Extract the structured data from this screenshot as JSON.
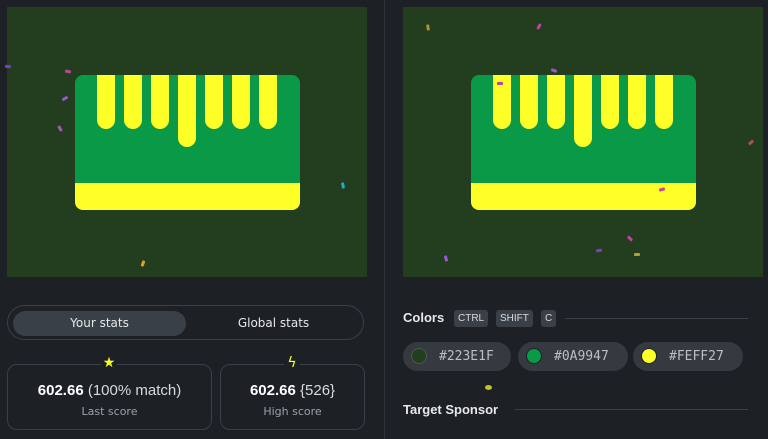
{
  "stats_tabs": {
    "your_stats": "Your stats",
    "global_stats": "Global stats"
  },
  "last_score": {
    "value": "602.66",
    "match": "(100% match)",
    "label": "Last score"
  },
  "high_score": {
    "value": "602.66",
    "rank": "{526}",
    "label": "High score"
  },
  "colors_section": {
    "title": "Colors",
    "shortcut": [
      "CTRL",
      "SHIFT",
      "C"
    ],
    "swatches": [
      {
        "hex": "#223E1F",
        "label": "#223E1F"
      },
      {
        "hex": "#0A9947",
        "label": "#0A9947"
      },
      {
        "hex": "#FEFF27",
        "label": "#FEFF27"
      }
    ]
  },
  "target_sponsor": {
    "title": "Target Sponsor"
  },
  "palette": {
    "background": "#223E1F",
    "card": "#0A9947",
    "accent": "#FEFF27",
    "page": "#1d2125"
  }
}
